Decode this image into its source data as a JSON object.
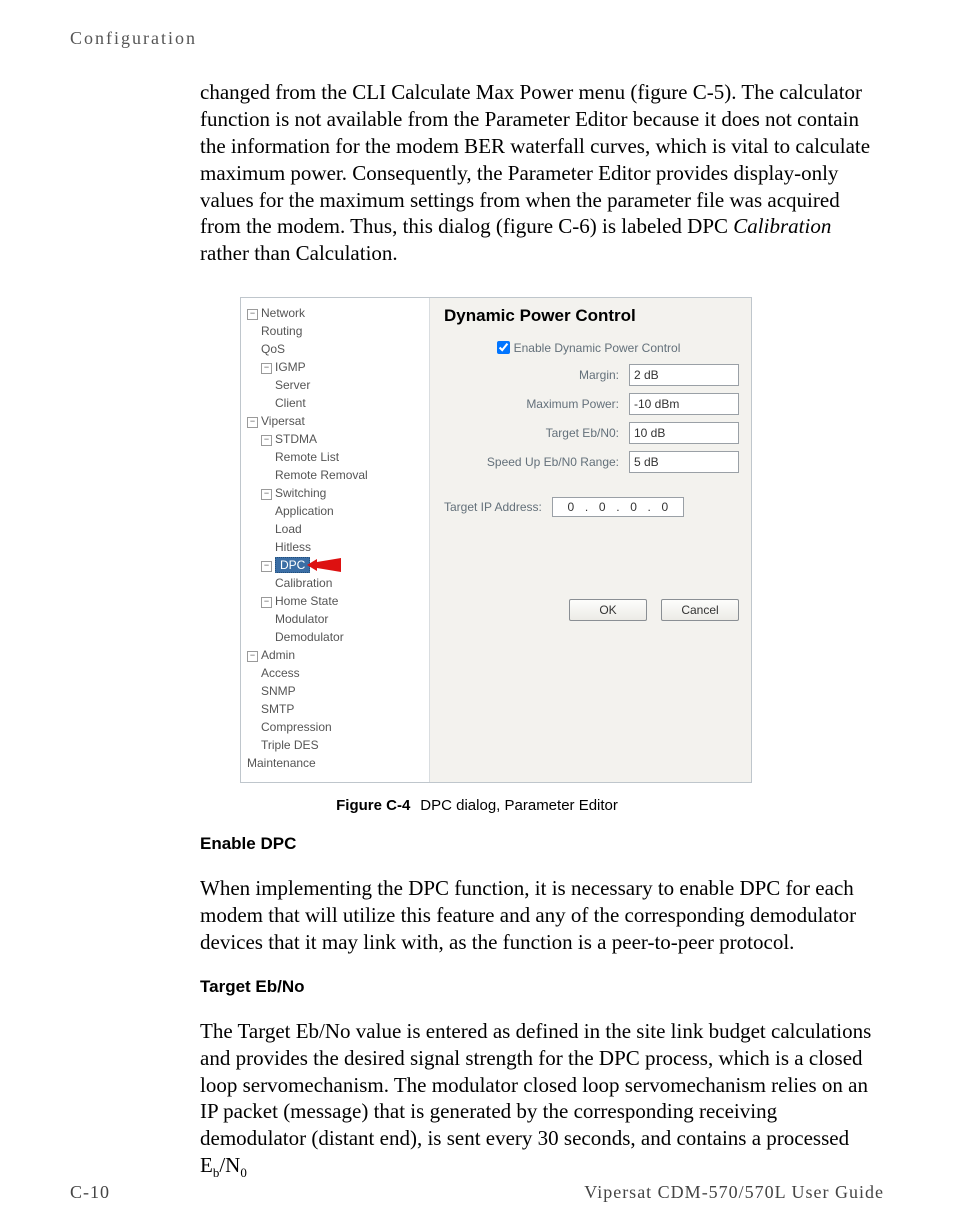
{
  "header": {
    "running": "Configuration"
  },
  "intro_paragraph": "changed from the CLI Calculate Max Power menu (figure C-5). The calculator function is not available from the Parameter Editor because it does not contain the information for the modem BER waterfall curves, which is vital to calculate maximum power. Consequently, the Parameter Editor provides display-only values for the maximum settings from when the parameter file was acquired from the modem. Thus, this dialog (figure C-6) is labeled DPC ",
  "intro_italic": "Calibration",
  "intro_tail": " rather than Calculation.",
  "tree": {
    "network": "Network",
    "routing": "Routing",
    "qos": "QoS",
    "igmp": "IGMP",
    "server": "Server",
    "client": "Client",
    "vipersat": "Vipersat",
    "stdma": "STDMA",
    "remote_list": "Remote List",
    "remote_removal": "Remote Removal",
    "switching": "Switching",
    "application": "Application",
    "load": "Load",
    "hitless": "Hitless",
    "dpc": "DPC",
    "calibration": "Calibration",
    "home_state": "Home State",
    "modulator": "Modulator",
    "demodulator": "Demodulator",
    "admin": "Admin",
    "access": "Access",
    "snmp": "SNMP",
    "smtp": "SMTP",
    "compression": "Compression",
    "triple_des": "Triple DES",
    "maintenance": "Maintenance"
  },
  "dpc_panel": {
    "title": "Dynamic Power Control",
    "enable_label": "Enable Dynamic Power Control",
    "enable_checked": true,
    "margin_label": "Margin:",
    "margin_value": "2 dB",
    "max_power_label": "Maximum Power:",
    "max_power_value": "-10 dBm",
    "target_ebn0_label": "Target Eb/N0:",
    "target_ebn0_value": "10 dB",
    "speedup_label": "Speed Up Eb/N0 Range:",
    "speedup_value": "5 dB",
    "target_ip_label": "Target IP Address:",
    "target_ip": [
      "0",
      "0",
      "0",
      "0"
    ],
    "ok": "OK",
    "cancel": "Cancel"
  },
  "figure": {
    "label": "Figure C-4",
    "caption": "DPC dialog, Parameter Editor"
  },
  "sections": {
    "enable_dpc_h": "Enable DPC",
    "enable_dpc_p": "When implementing the DPC function, it is necessary to enable DPC for each modem that will utilize this feature and any of the corresponding demodulator devices that it may link with, as the function is a peer-to-peer protocol.",
    "target_ebno_h": "Target Eb/No",
    "target_ebno_p_pre": "The Target Eb/No value is entered as defined in the site link budget calculations and provides the desired signal strength for the DPC process, which is a closed loop servomechanism. The modulator closed loop servomechanism relies on an IP packet (message) that is generated by the corresponding receiving demodulator (distant end), is sent every 30 seconds, and contains a processed E",
    "target_ebno_sub1": "b",
    "target_ebno_between": "/N",
    "target_ebno_sub2": "0"
  },
  "footer": {
    "left": "C-10",
    "right": "Vipersat CDM-570/570L User Guide"
  }
}
